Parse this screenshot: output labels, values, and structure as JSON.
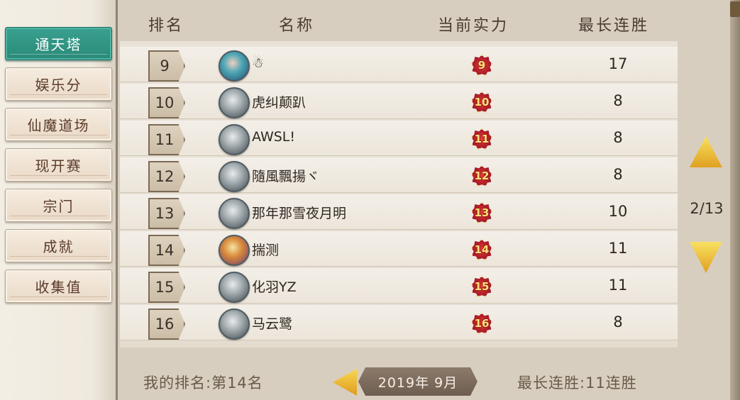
{
  "sidebar": {
    "items": [
      {
        "label": "通天塔",
        "active": true
      },
      {
        "label": "娱乐分",
        "active": false
      },
      {
        "label": "仙魔道场",
        "active": false
      },
      {
        "label": "现开赛",
        "active": false
      },
      {
        "label": "宗门",
        "active": false
      },
      {
        "label": "成就",
        "active": false
      },
      {
        "label": "收集值",
        "active": false
      }
    ]
  },
  "header": {
    "rank": "排名",
    "name": "名称",
    "power": "当前实力",
    "streak": "最长连胜"
  },
  "rows": [
    {
      "rank": "9",
      "name": "☃",
      "power": "9",
      "streak": "17"
    },
    {
      "rank": "10",
      "name": "虎纠颠趴",
      "power": "10",
      "streak": "8"
    },
    {
      "rank": "11",
      "name": "AWSL!",
      "power": "11",
      "streak": "8"
    },
    {
      "rank": "12",
      "name": "隨風飄揚ヾ",
      "power": "12",
      "streak": "8"
    },
    {
      "rank": "13",
      "name": "那年那雪夜月明",
      "power": "13",
      "streak": "10"
    },
    {
      "rank": "14",
      "name": "揣测",
      "power": "14",
      "streak": "11"
    },
    {
      "rank": "15",
      "name": "化羽YZ",
      "power": "15",
      "streak": "11"
    },
    {
      "rank": "16",
      "name": "马云鹭",
      "power": "16",
      "streak": "8"
    }
  ],
  "pager": {
    "indicator": "2/13"
  },
  "footer": {
    "my_rank": "我的排名:第14名",
    "date": "2019年  9月",
    "max_streak": "最长连胜:11连胜"
  },
  "colors": {
    "active_tab": "#2a8a78",
    "arrow": "#e8b830",
    "badge": "#b21e2a"
  }
}
